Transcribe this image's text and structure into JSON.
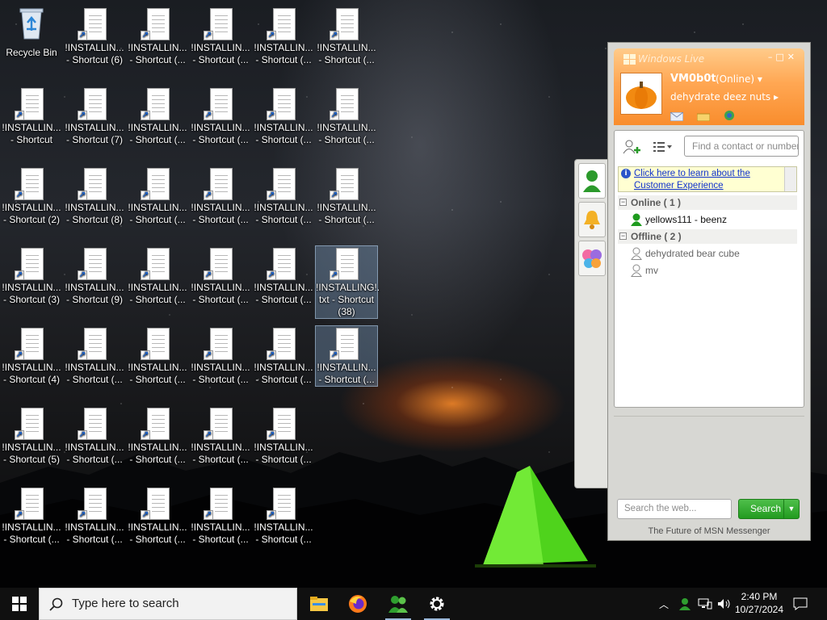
{
  "desktop": {
    "recycle_bin": "Recycle Bin",
    "icons": [
      [
        "!INSTALLIN...\n- Shortcut (6)",
        "!INSTALLIN...\n- Shortcut (...",
        "!INSTALLIN...\n- Shortcut (...",
        "!INSTALLIN...\n- Shortcut (...",
        "!INSTALLIN...\n- Shortcut (..."
      ],
      [
        "!INSTALLIN...\n- Shortcut",
        "!INSTALLIN...\n- Shortcut (7)",
        "!INSTALLIN...\n- Shortcut (...",
        "!INSTALLIN...\n- Shortcut (...",
        "!INSTALLIN...\n- Shortcut (...",
        "!INSTALLIN...\n- Shortcut (..."
      ],
      [
        "!INSTALLIN...\n- Shortcut (2)",
        "!INSTALLIN...\n- Shortcut (8)",
        "!INSTALLIN...\n- Shortcut (...",
        "!INSTALLIN...\n- Shortcut (...",
        "!INSTALLIN...\n- Shortcut (...",
        "!INSTALLIN...\n- Shortcut (..."
      ],
      [
        "!INSTALLIN...\n- Shortcut (3)",
        "!INSTALLIN...\n- Shortcut (9)",
        "!INSTALLIN...\n- Shortcut (...",
        "!INSTALLIN...\n- Shortcut (...",
        "!INSTALLIN...\n- Shortcut (...",
        "!INSTALLING!.\ntxt - Shortcut\n(38)"
      ],
      [
        "!INSTALLIN...\n- Shortcut (4)",
        "!INSTALLIN...\n- Shortcut (...",
        "!INSTALLIN...\n- Shortcut (...",
        "!INSTALLIN...\n- Shortcut (...",
        "!INSTALLIN...\n- Shortcut (...",
        "!INSTALLIN...\n- Shortcut (..."
      ],
      [
        "!INSTALLIN...\n- Shortcut (5)",
        "!INSTALLIN...\n- Shortcut (...",
        "!INSTALLIN...\n- Shortcut (...",
        "!INSTALLIN...\n- Shortcut (...",
        "!INSTALLIN...\n- Shortcut (..."
      ],
      [
        "!INSTALLIN...\n- Shortcut (...",
        "!INSTALLIN...\n- Shortcut (...",
        "!INSTALLIN...\n- Shortcut (...",
        "!INSTALLIN...\n- Shortcut (...",
        "!INSTALLIN...\n- Shortcut (..."
      ]
    ]
  },
  "messenger": {
    "title": "Windows Live",
    "username": "VM0b0t",
    "status": "(Online)",
    "personal_message": "dehydrate deez nuts",
    "find_placeholder": "Find a contact or number...",
    "notice": "Click here to learn about the Customer Experience",
    "groups": [
      {
        "label": "Online ( 1 )",
        "contacts": [
          {
            "name": "yellows111 - beenz",
            "online": true
          }
        ]
      },
      {
        "label": "Offline ( 2 )",
        "contacts": [
          {
            "name": "dehydrated bear cube",
            "online": false
          },
          {
            "name": "mv",
            "online": false
          }
        ]
      }
    ],
    "web_search_placeholder": "Search the web...",
    "search_button": "Search",
    "footer": "The Future of MSN Messenger",
    "accent": "#f98d2d",
    "online_color": "#1f9b1f"
  },
  "taskbar": {
    "search_placeholder": "Type here to search",
    "apps": [
      "file-explorer",
      "firefox",
      "messenger",
      "settings"
    ],
    "time": "2:40 PM",
    "date": "10/27/2024"
  }
}
